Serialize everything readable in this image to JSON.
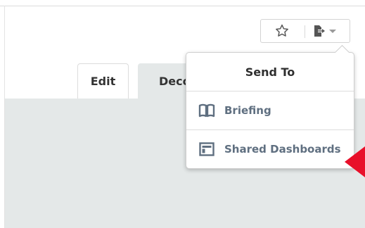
{
  "tabs": [
    {
      "label": "Edit"
    },
    {
      "label": "Deco"
    }
  ],
  "toolbar": {
    "favorite_icon": "star-outline-icon",
    "export_icon": "export-icon"
  },
  "send_to_menu": {
    "header": "Send To",
    "items": [
      {
        "label": "Briefing",
        "icon": "book-icon"
      },
      {
        "label": "Shared Dashboards",
        "icon": "dashboard-layout-icon"
      }
    ]
  },
  "colors": {
    "menu_item_text": "#5f6f80",
    "panel_bg": "#e4e8e8",
    "annotation_arrow": "#e8102a"
  }
}
